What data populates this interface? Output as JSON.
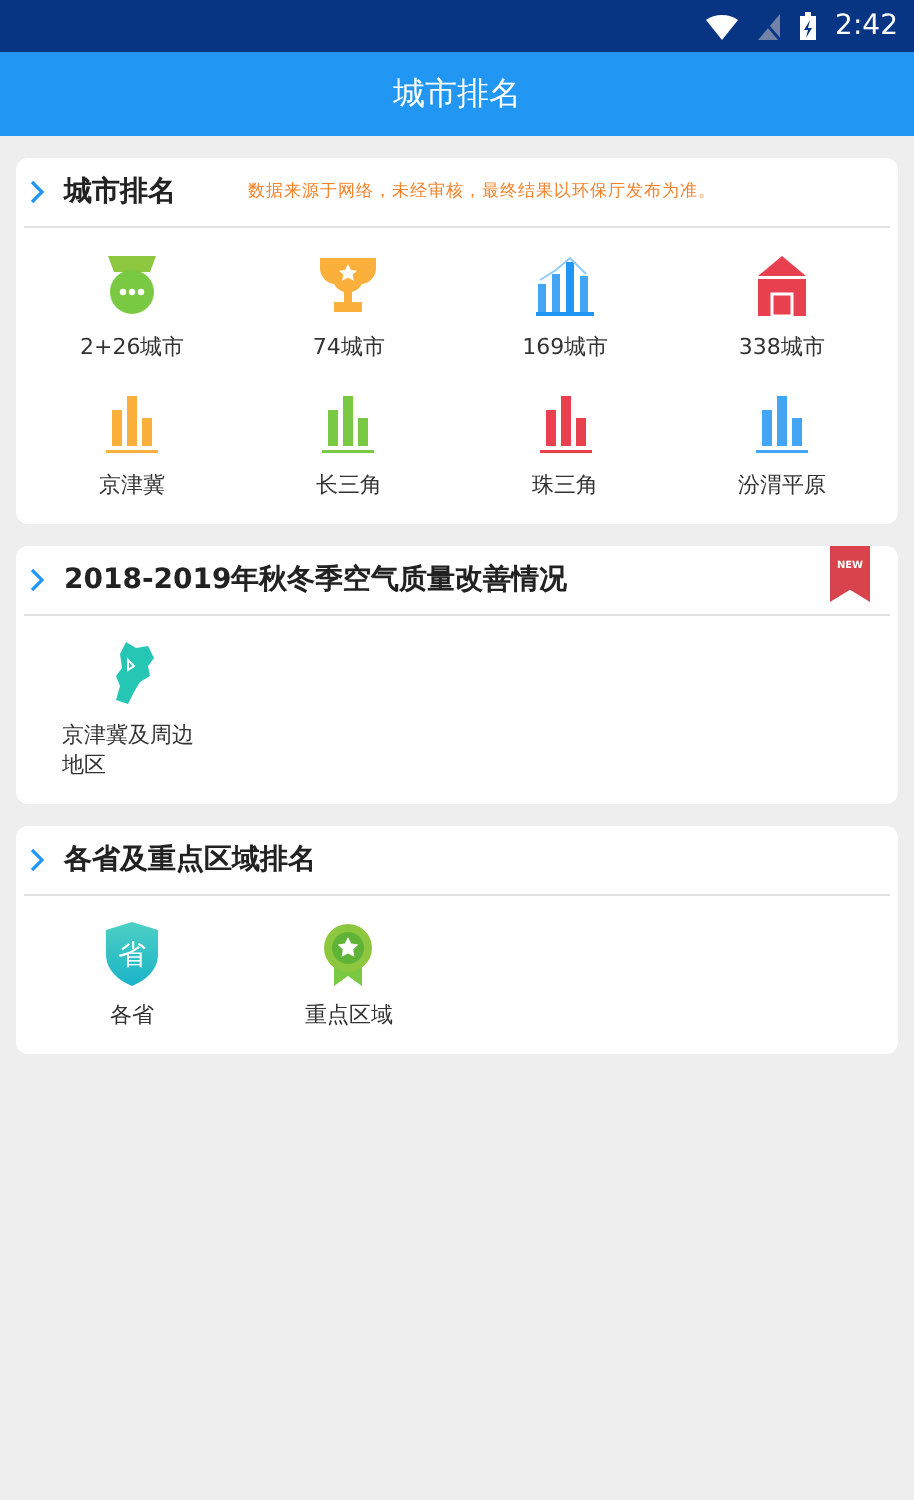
{
  "status_bar": {
    "time": "2:42"
  },
  "app_bar": {
    "title": "城市排名"
  },
  "sections": [
    {
      "title": "城市排名",
      "note": "数据来源于网络，未经审核，最终结果以环保厅发布为准。",
      "items": [
        {
          "kind": "medal",
          "label": "2+26城市"
        },
        {
          "kind": "trophy",
          "label": "74城市"
        },
        {
          "kind": "chart",
          "label": "169城市"
        },
        {
          "kind": "house",
          "label": "338城市"
        },
        {
          "kind": "bars",
          "label": "京津冀",
          "color": "#fbb03b"
        },
        {
          "kind": "bars",
          "label": "长三角",
          "color": "#7ac943"
        },
        {
          "kind": "bars",
          "label": "珠三角",
          "color": "#e8404f"
        },
        {
          "kind": "bars",
          "label": "汾渭平原",
          "color": "#42a5f5"
        }
      ]
    },
    {
      "title": "2018-2019年秋冬季空气质量改善情况",
      "ribbon": "NEW",
      "items": [
        {
          "kind": "map",
          "label": "京津冀及周边地区"
        }
      ]
    },
    {
      "title": "各省及重点区域排名",
      "items": [
        {
          "kind": "shield",
          "label": "各省",
          "icon_text": "省"
        },
        {
          "kind": "badge",
          "label": "重点区域"
        }
      ]
    }
  ]
}
